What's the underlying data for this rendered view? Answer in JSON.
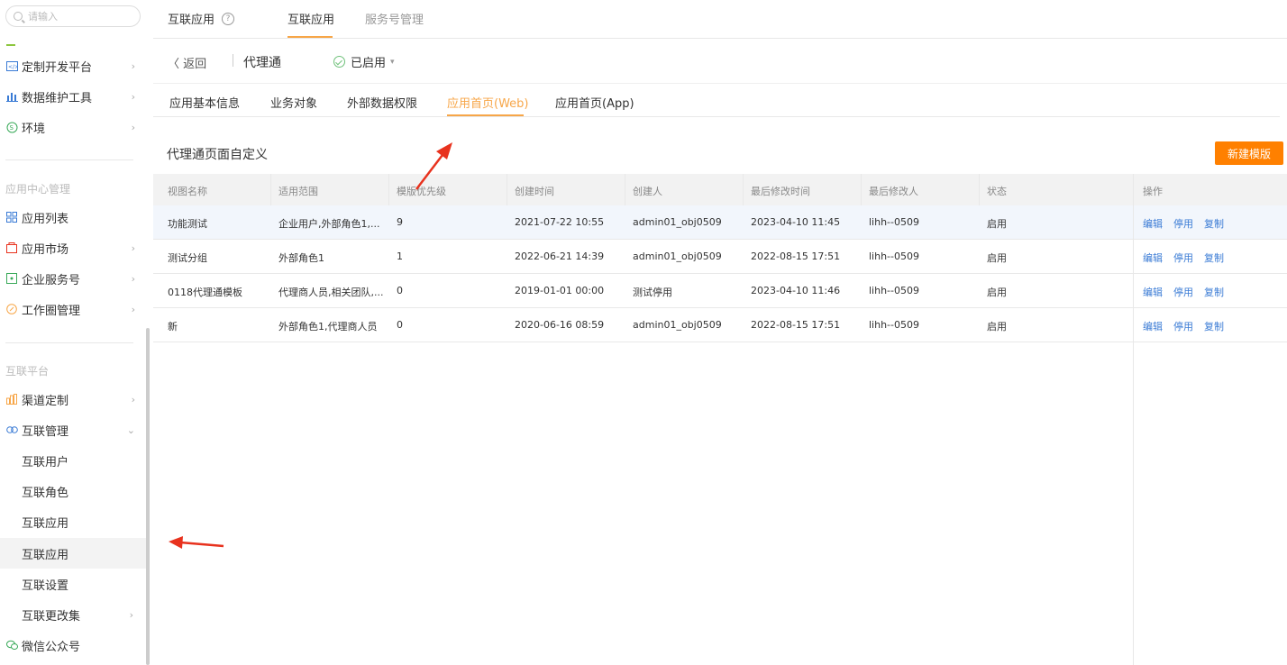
{
  "sidebar": {
    "search_placeholder": "请输入",
    "items_top": [
      {
        "label": "定制开发平台",
        "icon": "code-icon",
        "arrow": "›"
      },
      {
        "label": "数据维护工具",
        "icon": "bar-chart-icon",
        "arrow": "›"
      },
      {
        "label": "环境",
        "icon": "environment-icon",
        "arrow": "›"
      }
    ],
    "section_app_center": "应用中心管理",
    "items_app": [
      {
        "label": "应用列表",
        "icon": "grid-icon",
        "arrow": ""
      },
      {
        "label": "应用市场",
        "icon": "market-icon",
        "arrow": "›"
      },
      {
        "label": "企业服务号",
        "icon": "service-icon",
        "arrow": "›"
      },
      {
        "label": "工作圈管理",
        "icon": "circle-icon",
        "arrow": "›"
      }
    ],
    "section_interconnect": "互联平台",
    "items_interconnect": [
      {
        "label": "渠道定制",
        "icon": "channel-icon",
        "arrow": "›"
      },
      {
        "label": "互联管理",
        "icon": "link-icon",
        "arrow": "⌄"
      }
    ],
    "subitems": [
      {
        "label": "互联用户",
        "arrow": ""
      },
      {
        "label": "互联角色",
        "arrow": ""
      },
      {
        "label": "互联应用",
        "arrow": ""
      },
      {
        "label": "互联应用",
        "arrow": ""
      },
      {
        "label": "互联设置",
        "arrow": ""
      },
      {
        "label": "互联更改集",
        "arrow": "›"
      }
    ],
    "wechat": {
      "label": "微信公众号",
      "icon": "wechat-icon"
    }
  },
  "topbar": {
    "title": "互联应用",
    "help": "?",
    "tabs": [
      "互联应用",
      "服务号管理"
    ]
  },
  "subbar": {
    "back": "〈  返回",
    "app_name": "代理通",
    "status": "已启用",
    "caret": "▾"
  },
  "tabs": [
    "应用基本信息",
    "业务对象",
    "外部数据权限",
    "应用首页(Web)",
    "应用首页(App)"
  ],
  "section": {
    "title": "代理通页面自定义",
    "new_button": "新建模版"
  },
  "table": {
    "headers": [
      "视图名称",
      "适用范围",
      "模版优先级",
      "创建时间",
      "创建人",
      "最后修改时间",
      "最后修改人",
      "状态",
      "操作"
    ],
    "rows": [
      [
        "功能测试",
        "企业用户,外部角色1,...",
        "9",
        "2021-07-22 10:55",
        "admin01_obj0509",
        "2023-04-10 11:45",
        "lihh--0509",
        "启用"
      ],
      [
        "测试分组",
        "外部角色1",
        "1",
        "2022-06-21 14:39",
        "admin01_obj0509",
        "2022-08-15 17:51",
        "lihh--0509",
        "启用"
      ],
      [
        "0118代理通模板",
        "代理商人员,相关团队,...",
        "0",
        "2019-01-01 00:00",
        "测试停用",
        "2023-04-10 11:46",
        "lihh--0509",
        "启用"
      ],
      [
        "新",
        "外部角色1,代理商人员",
        "0",
        "2020-06-16 08:59",
        "admin01_obj0509",
        "2022-08-15 17:51",
        "lihh--0509",
        "启用"
      ]
    ],
    "ops": [
      "编辑",
      "停用",
      "复制"
    ]
  },
  "colors": {
    "accent": "#f7a648",
    "button": "#ff8000",
    "link": "#3a7bd5",
    "arrow": "#e8321e"
  }
}
